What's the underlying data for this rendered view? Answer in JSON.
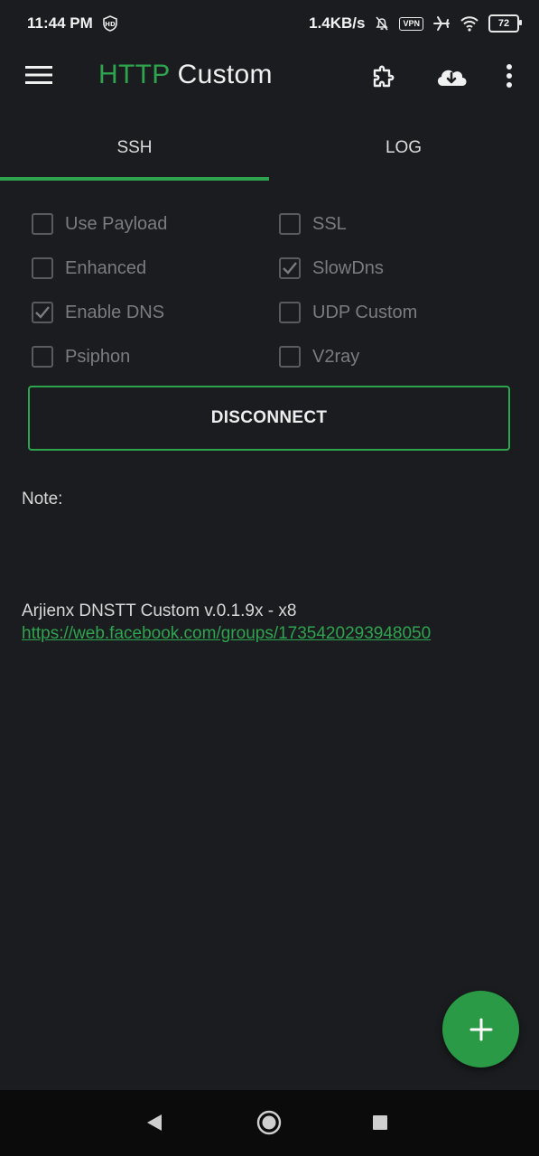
{
  "status_bar": {
    "time": "11:44 PM",
    "speed": "1.4KB/s",
    "vpn_label": "VPN",
    "battery": "72",
    "icons": [
      "hd-shield-icon",
      "bell-off-icon",
      "vpn-icon",
      "airplane-icon",
      "wifi-icon",
      "battery-icon"
    ]
  },
  "app_bar": {
    "title_part1": "HTTP",
    "title_part2": "Custom",
    "icons": [
      "menu-icon",
      "puzzle-icon",
      "cloud-download-icon",
      "more-vert-icon"
    ]
  },
  "tabs": [
    {
      "label": "SSH",
      "active": true
    },
    {
      "label": "LOG",
      "active": false
    }
  ],
  "options": [
    {
      "label": "Use Payload",
      "checked": false
    },
    {
      "label": "SSL",
      "checked": false
    },
    {
      "label": "Enhanced",
      "checked": false
    },
    {
      "label": "SlowDns",
      "checked": true
    },
    {
      "label": "Enable DNS",
      "checked": true
    },
    {
      "label": "UDP Custom",
      "checked": false
    },
    {
      "label": "Psiphon",
      "checked": false
    },
    {
      "label": "V2ray",
      "checked": false
    }
  ],
  "main": {
    "disconnect_label": "DISCONNECT",
    "note_label": "Note:",
    "info_text": "Arjienx DNSTT Custom v.0.1.9x - x8",
    "link_text": "https://web.facebook.com/groups/1735420293948050"
  },
  "fab": {
    "icon": "plus-icon"
  },
  "nav_bar": {
    "icons": [
      "back-icon",
      "home-icon",
      "recents-icon"
    ]
  },
  "colors": {
    "accent": "#2ea44f",
    "background": "#1b1c1f"
  }
}
